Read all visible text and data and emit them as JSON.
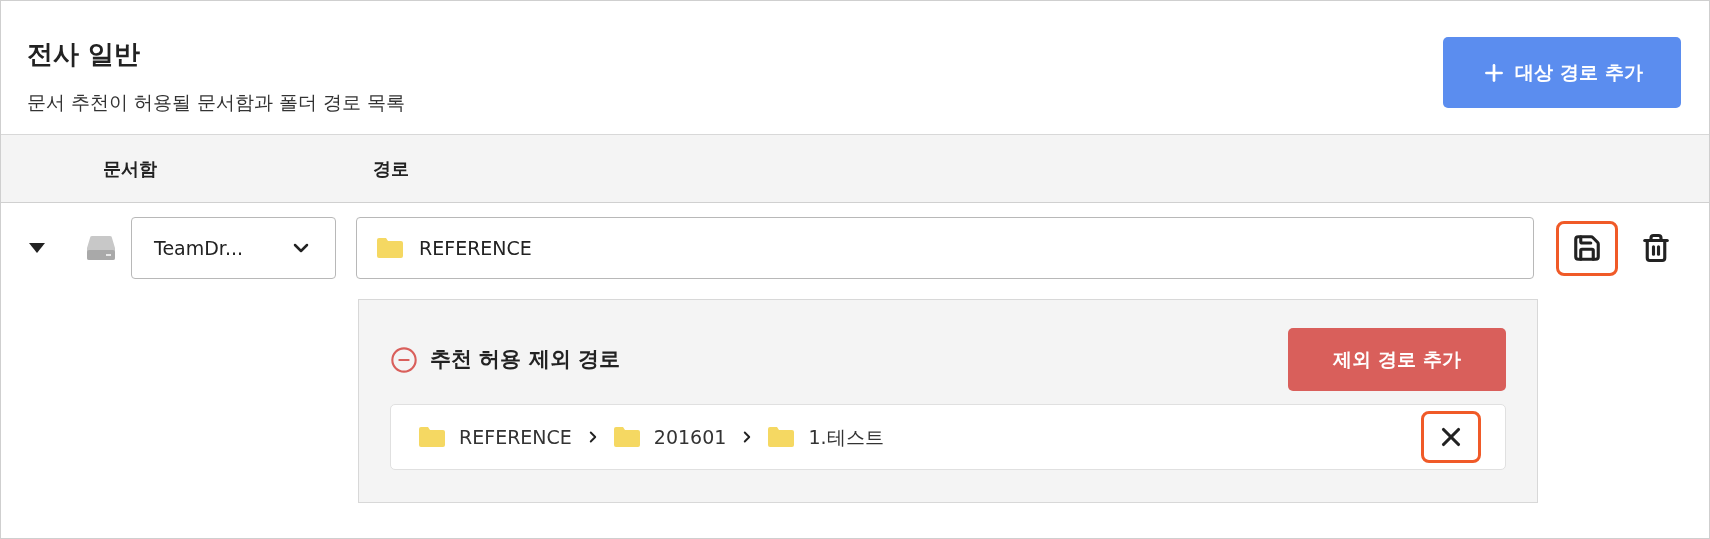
{
  "section": {
    "title": "전사 일반",
    "subtitle": "문서 추천이 허용될 문서함과 폴더 경로 목록"
  },
  "add_button": {
    "label": "대상 경로 추가"
  },
  "columns": [
    "문서함",
    "경로"
  ],
  "rows": [
    {
      "expanded": true,
      "drive": "TeamDr...",
      "path": "REFERENCE",
      "save_highlighted": true,
      "exclusions": {
        "title": "추천 허용 제외 경로",
        "add_button": "제외 경로 추가",
        "paths": [
          {
            "segments": [
              "REFERENCE",
              "201601",
              "1.테스트"
            ],
            "remove_highlighted": true
          }
        ]
      }
    }
  ]
}
